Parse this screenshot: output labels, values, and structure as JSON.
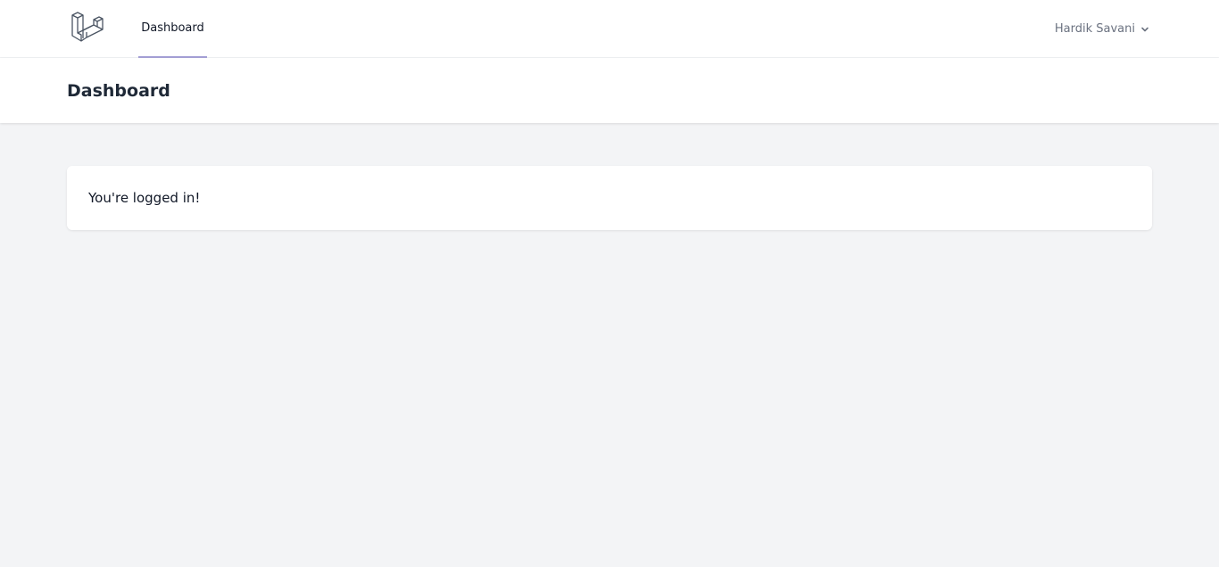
{
  "nav": {
    "logo_icon": "laravel-logo-icon",
    "links": [
      {
        "label": "Dashboard",
        "active": true
      }
    ],
    "active_color": "#a5a0d6",
    "user": {
      "name": "Hardik Savani",
      "dropdown_icon": "chevron-down-icon"
    }
  },
  "header": {
    "title": "Dashboard"
  },
  "main": {
    "message": "You're logged in!"
  }
}
